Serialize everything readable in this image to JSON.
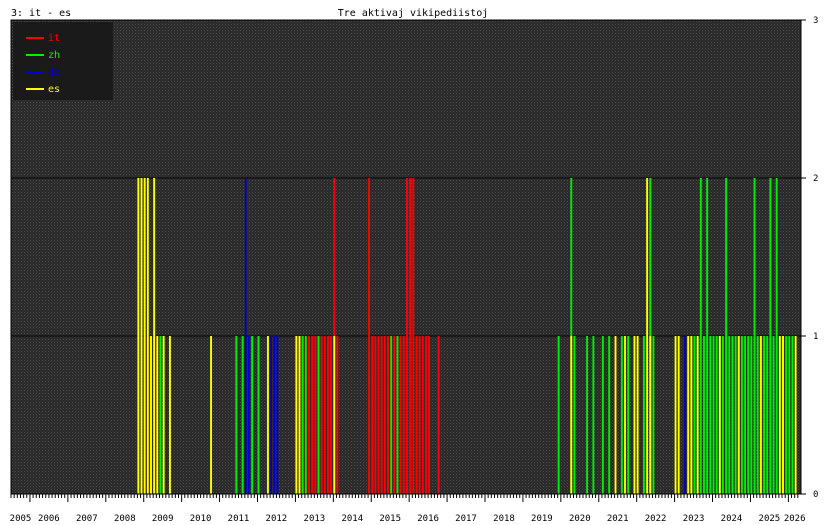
{
  "header": {
    "panel_label": "3: it - es",
    "title": "Tre aktivaj vikipediistoj"
  },
  "chart_data": {
    "type": "bar",
    "title": "Tre aktivaj vikipediistoj",
    "xlabel": "",
    "ylabel": "",
    "ylim": [
      0,
      3
    ],
    "y_ticks": [
      "0",
      "1",
      "2",
      "3"
    ],
    "x_range": [
      "2005-07",
      "2026-04"
    ],
    "year_labels": [
      "2005",
      "2006",
      "2007",
      "2008",
      "2009",
      "2010",
      "2011",
      "2012",
      "2013",
      "2014",
      "2015",
      "2016",
      "2017",
      "2018",
      "2019",
      "2020",
      "2021",
      "2022",
      "2023",
      "2024",
      "2025",
      "2026"
    ],
    "grid": true,
    "background": "#2a2a2a",
    "legend_position": "top-left",
    "series": [
      {
        "name": "it",
        "color": "#ff0000",
        "points": [
          [
            "2009-02",
            1
          ],
          [
            "2009-03",
            1
          ],
          [
            "2009-04",
            1
          ],
          [
            "2013-01",
            1
          ],
          [
            "2013-02",
            1
          ],
          [
            "2013-03",
            1
          ],
          [
            "2013-04",
            1
          ],
          [
            "2013-05",
            1
          ],
          [
            "2013-06",
            1
          ],
          [
            "2013-07",
            1
          ],
          [
            "2013-08",
            1
          ],
          [
            "2013-09",
            1
          ],
          [
            "2013-10",
            1
          ],
          [
            "2013-11",
            1
          ],
          [
            "2013-12",
            1
          ],
          [
            "2014-01",
            2
          ],
          [
            "2014-02",
            1
          ],
          [
            "2014-12",
            2
          ],
          [
            "2015-01",
            1
          ],
          [
            "2015-02",
            1
          ],
          [
            "2015-03",
            1
          ],
          [
            "2015-04",
            1
          ],
          [
            "2015-05",
            1
          ],
          [
            "2015-06",
            1
          ],
          [
            "2015-07",
            1
          ],
          [
            "2015-08",
            1
          ],
          [
            "2015-09",
            1
          ],
          [
            "2015-10",
            1
          ],
          [
            "2015-11",
            1
          ],
          [
            "2015-12",
            2
          ],
          [
            "2016-01",
            2
          ],
          [
            "2016-02",
            2
          ],
          [
            "2016-03",
            1
          ],
          [
            "2016-04",
            1
          ],
          [
            "2016-05",
            1
          ],
          [
            "2016-06",
            1
          ],
          [
            "2016-07",
            1
          ],
          [
            "2016-10",
            1
          ]
        ]
      },
      {
        "name": "zh",
        "color": "#00ee00",
        "points": [
          [
            "2009-06",
            1
          ],
          [
            "2009-07",
            1
          ],
          [
            "2011-06",
            1
          ],
          [
            "2011-08",
            1
          ],
          [
            "2011-10",
            1
          ],
          [
            "2011-11",
            1
          ],
          [
            "2012-01",
            1
          ],
          [
            "2013-03",
            1
          ],
          [
            "2013-04",
            1
          ],
          [
            "2013-08",
            1
          ],
          [
            "2015-07",
            1
          ],
          [
            "2015-09",
            1
          ],
          [
            "2019-12",
            1
          ],
          [
            "2020-04",
            2
          ],
          [
            "2020-05",
            1
          ],
          [
            "2020-09",
            1
          ],
          [
            "2020-11",
            1
          ],
          [
            "2021-02",
            1
          ],
          [
            "2021-04",
            1
          ],
          [
            "2021-08",
            1
          ],
          [
            "2021-10",
            1
          ],
          [
            "2022-03",
            1
          ],
          [
            "2022-05",
            2
          ],
          [
            "2022-06",
            1
          ],
          [
            "2023-06",
            1
          ],
          [
            "2023-07",
            1
          ],
          [
            "2023-08",
            1
          ],
          [
            "2023-09",
            2
          ],
          [
            "2023-10",
            1
          ],
          [
            "2023-11",
            2
          ],
          [
            "2023-12",
            1
          ],
          [
            "2024-01",
            1
          ],
          [
            "2024-02",
            1
          ],
          [
            "2024-03",
            1
          ],
          [
            "2024-04",
            1
          ],
          [
            "2024-05",
            2
          ],
          [
            "2024-06",
            1
          ],
          [
            "2024-07",
            1
          ],
          [
            "2024-08",
            1
          ],
          [
            "2024-09",
            1
          ],
          [
            "2024-10",
            1
          ],
          [
            "2024-11",
            1
          ],
          [
            "2024-12",
            1
          ],
          [
            "2025-01",
            1
          ],
          [
            "2025-02",
            2
          ],
          [
            "2025-03",
            1
          ],
          [
            "2025-04",
            1
          ],
          [
            "2025-05",
            1
          ],
          [
            "2025-06",
            1
          ],
          [
            "2025-07",
            2
          ],
          [
            "2025-08",
            1
          ],
          [
            "2025-09",
            2
          ],
          [
            "2025-10",
            1
          ],
          [
            "2025-11",
            1
          ],
          [
            "2025-12",
            1
          ],
          [
            "2026-01",
            1
          ],
          [
            "2026-02",
            1
          ]
        ]
      },
      {
        "name": "de",
        "color": "#0000cc",
        "points": [
          [
            "2011-09",
            2
          ],
          [
            "2011-10",
            1
          ],
          [
            "2012-05",
            1
          ],
          [
            "2012-06",
            1
          ],
          [
            "2012-07",
            1
          ],
          [
            "2023-04",
            1
          ]
        ]
      },
      {
        "name": "es",
        "color": "#ffff00",
        "points": [
          [
            "2008-11",
            2
          ],
          [
            "2008-12",
            2
          ],
          [
            "2009-01",
            2
          ],
          [
            "2009-02",
            2
          ],
          [
            "2009-03",
            1
          ],
          [
            "2009-04",
            2
          ],
          [
            "2009-05",
            1
          ],
          [
            "2009-07",
            1
          ],
          [
            "2009-09",
            1
          ],
          [
            "2010-10",
            1
          ],
          [
            "2012-04",
            1
          ],
          [
            "2013-01",
            1
          ],
          [
            "2013-02",
            1
          ],
          [
            "2014-01",
            1
          ],
          [
            "2020-04",
            1
          ],
          [
            "2021-06",
            1
          ],
          [
            "2021-09",
            1
          ],
          [
            "2021-12",
            1
          ],
          [
            "2022-01",
            1
          ],
          [
            "2022-04",
            2
          ],
          [
            "2022-05",
            1
          ],
          [
            "2023-01",
            1
          ],
          [
            "2023-02",
            1
          ],
          [
            "2023-05",
            1
          ],
          [
            "2023-06",
            1
          ],
          [
            "2023-08",
            1
          ],
          [
            "2024-03",
            1
          ],
          [
            "2024-09",
            1
          ],
          [
            "2025-04",
            1
          ],
          [
            "2025-10",
            1
          ],
          [
            "2025-11",
            1
          ],
          [
            "2026-03",
            1
          ]
        ]
      }
    ]
  }
}
